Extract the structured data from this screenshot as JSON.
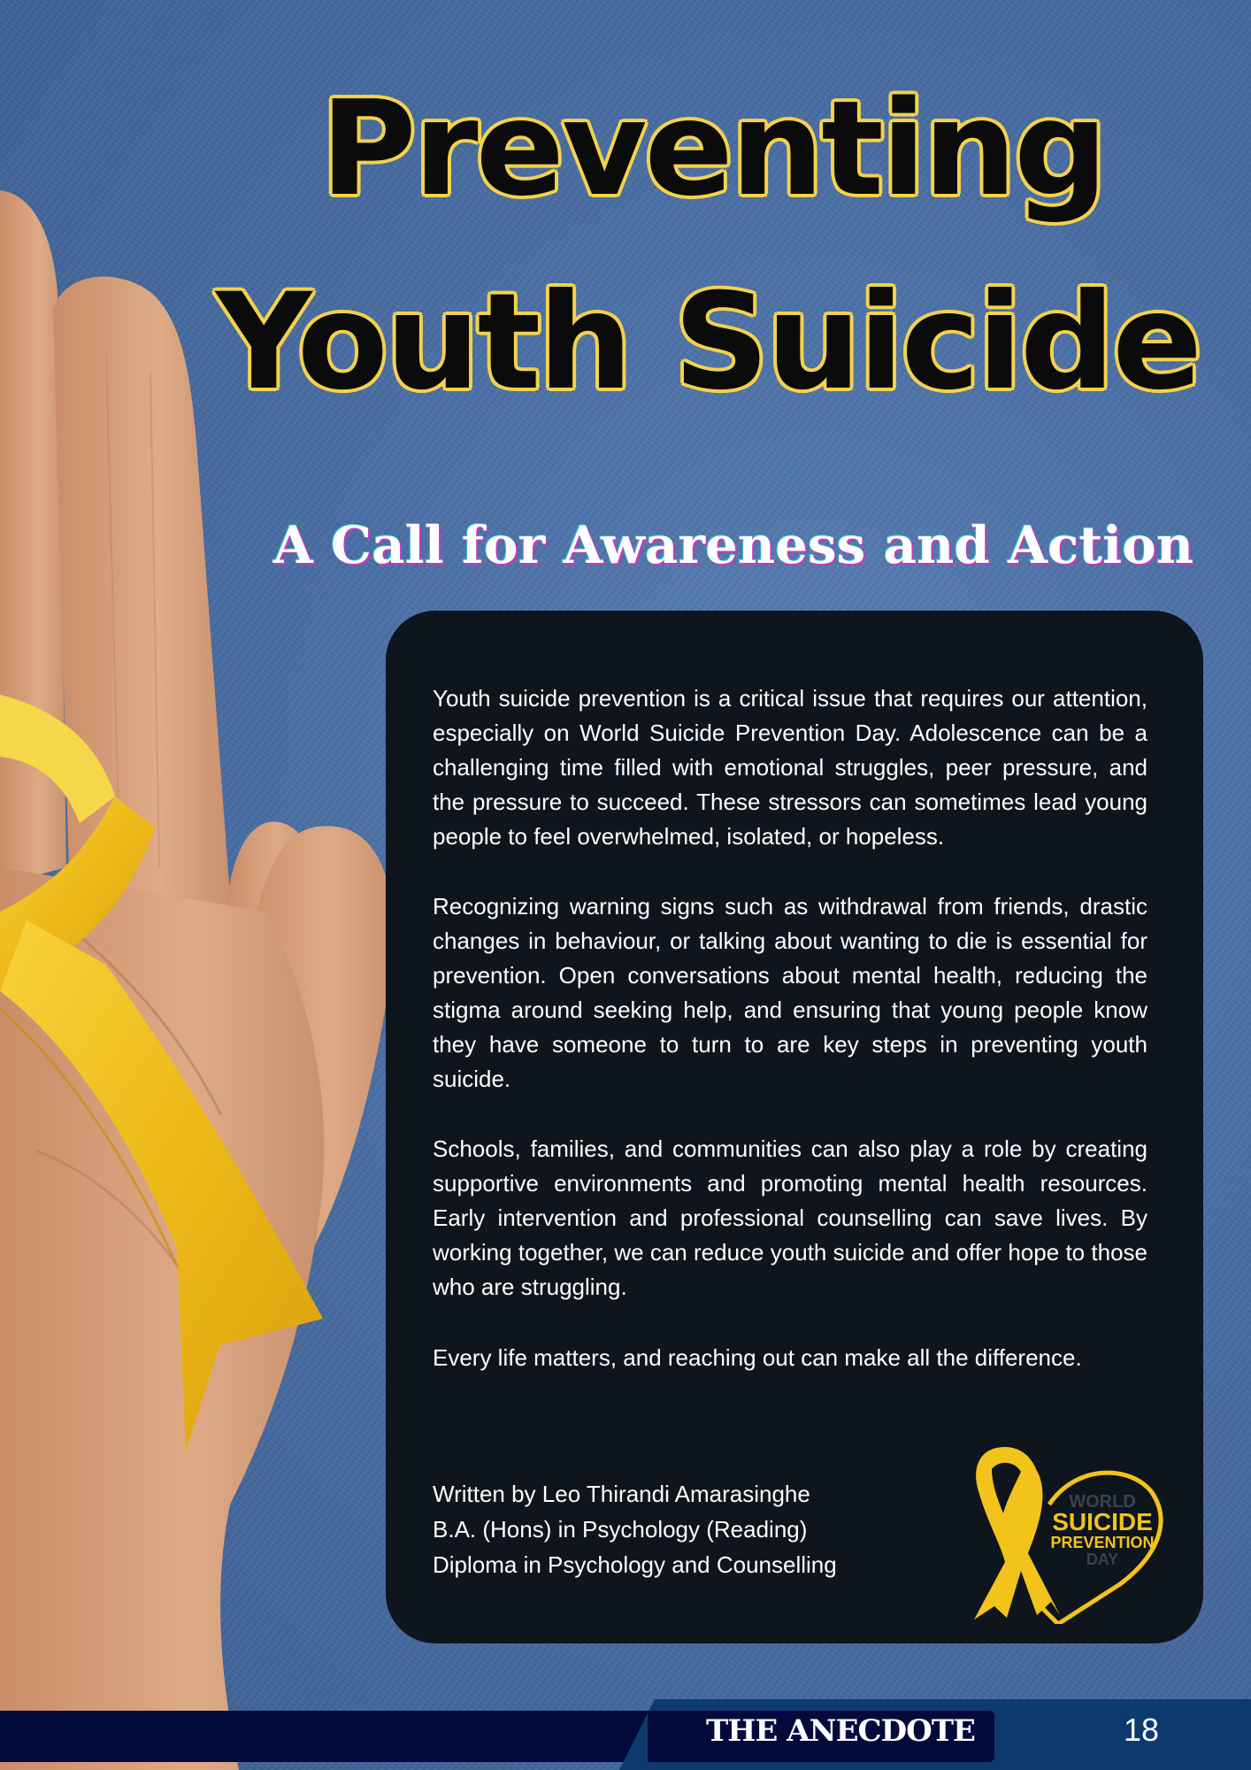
{
  "title_line1": "Preventing",
  "title_line2": "Youth Suicide",
  "subtitle": "A Call for Awareness and Action",
  "paragraphs": [
    "Youth suicide prevention is a critical issue that requires our attention, especially on World Suicide Prevention Day. Adolescence can be a challenging time filled with emotional struggles, peer pressure, and the pressure to succeed. These stressors can sometimes lead young people to feel overwhelmed, isolated, or hopeless.",
    "Recognizing warning signs such as withdrawal from friends, drastic changes in behaviour, or talking about wanting to die is essential for prevention. Open conversations about mental health, reducing the stigma around seeking help, and ensuring that young people know they have someone to turn to are key steps in preventing youth suicide.",
    "Schools, families, and communities can also play a role by creating supportive environments and promoting mental health resources. Early intervention and professional counselling can save lives. By working together, we can reduce youth suicide and offer hope to those who are struggling.",
    "Every life matters, and reaching out can make all the difference."
  ],
  "author": {
    "line1": "Written by Leo Thirandi Amarasinghe",
    "line2": "B.A. (Hons) in Psychology (Reading)",
    "line3": "Diploma in Psychology and Counselling"
  },
  "logo": {
    "word1": "WORLD",
    "word2": "SUICIDE",
    "word3": "PREVENTION",
    "word4": "DAY",
    "icon": "yellow-ribbon-heart-icon"
  },
  "footer": {
    "brand": "THE ANECDOTE",
    "page_number": "18"
  },
  "colors": {
    "background": "#4a6fa5",
    "card": "#0f151d",
    "title_outline": "#f4d24b",
    "ribbon": "#f2c31a",
    "footer": "#050a3c"
  }
}
